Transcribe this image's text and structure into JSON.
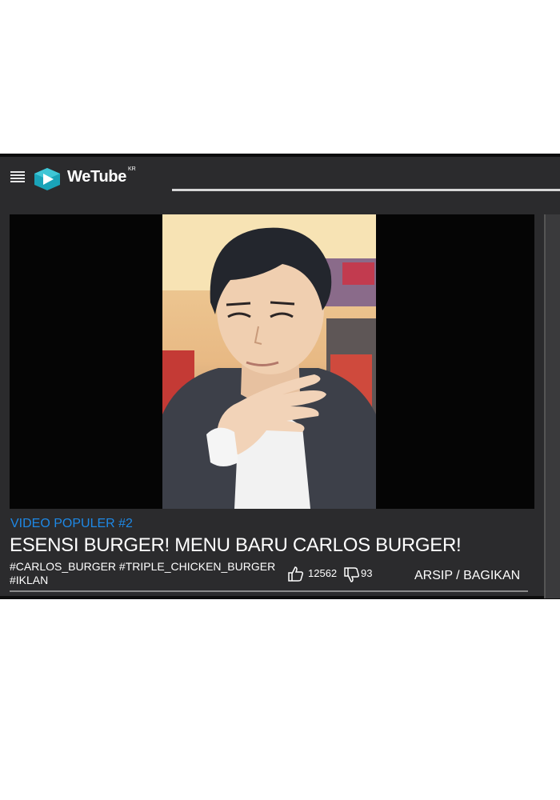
{
  "app": {
    "name": "WeTube",
    "region": "KR",
    "brand_color": "#1aa3b8"
  },
  "icons": {
    "menu": "hamburger-menu-icon",
    "logo": "play-hexagon-logo-icon",
    "like": "thumbs-up-icon",
    "dislike": "thumbs-down-icon"
  },
  "video": {
    "rank_label": "VIDEO POPULER #2",
    "title": "ESENSI BURGER! MENU BARU CARLOS BURGER!",
    "tags_line1": "#CARLOS_BURGER #TRIPLE_CHICKEN_BURGER",
    "tags_line2": "#IKLAN",
    "likes": "12562",
    "dislikes": "93",
    "action_label": "ARSIP / BAGIKAN"
  },
  "colors": {
    "frame_bg": "#2b2b2d",
    "accent_blue": "#1e88e5",
    "player_bg": "#050505"
  }
}
